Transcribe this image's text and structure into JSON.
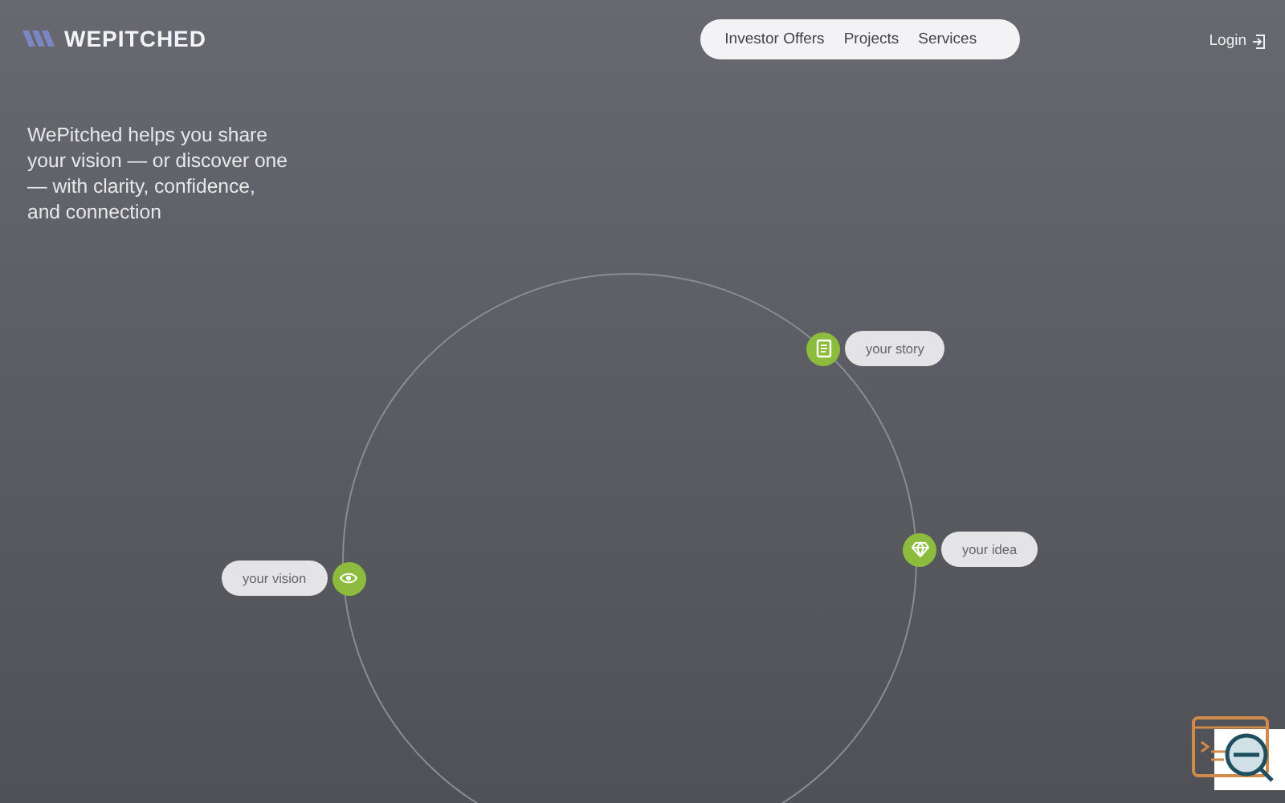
{
  "header": {
    "logo": "WEPITCHED",
    "nav": [
      {
        "label": "Investor Offers"
      },
      {
        "label": "Projects"
      },
      {
        "label": "Services"
      }
    ],
    "login": "Login"
  },
  "hero": {
    "tagline": "WePitched helps you share your vision — or discover one — with clarity, confidence, and connection"
  },
  "orbit": {
    "nodes": [
      {
        "kind": "story",
        "label": "your story"
      },
      {
        "kind": "idea",
        "label": "your idea"
      },
      {
        "kind": "vision",
        "label": "your vision"
      }
    ]
  }
}
